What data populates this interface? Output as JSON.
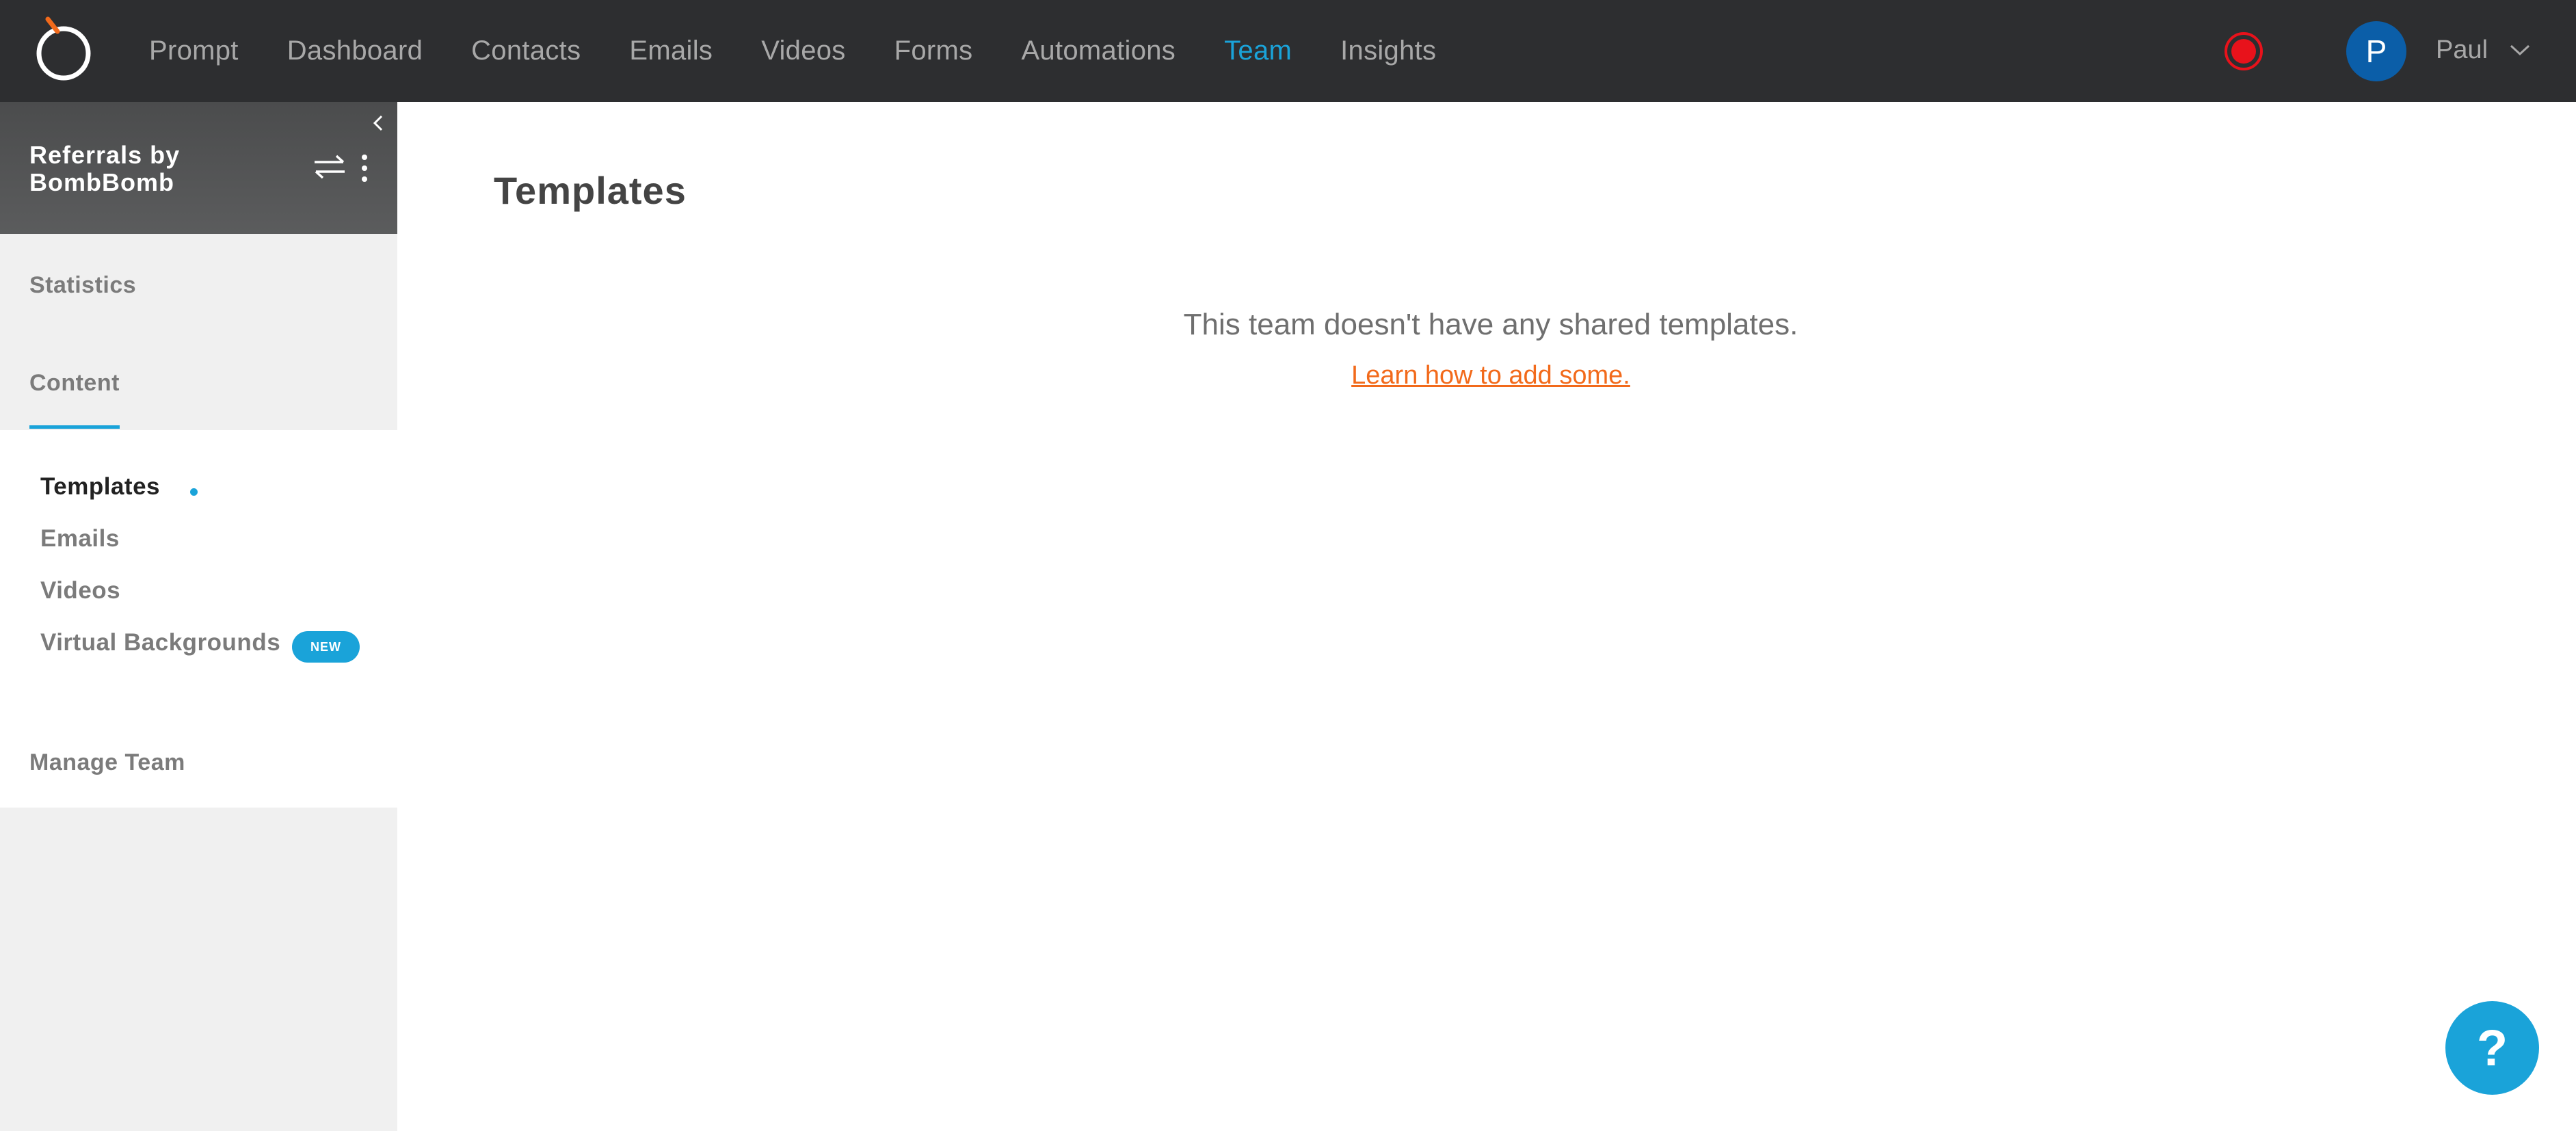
{
  "nav": {
    "logo_icon": "bombbomb-logo-icon",
    "items": [
      {
        "label": "Prompt",
        "active": false
      },
      {
        "label": "Dashboard",
        "active": false
      },
      {
        "label": "Contacts",
        "active": false
      },
      {
        "label": "Emails",
        "active": false
      },
      {
        "label": "Videos",
        "active": false
      },
      {
        "label": "Forms",
        "active": false
      },
      {
        "label": "Automations",
        "active": false
      },
      {
        "label": "Team",
        "active": true
      },
      {
        "label": "Insights",
        "active": false
      }
    ],
    "record_icon": "record-icon",
    "user": {
      "avatar_initial": "P",
      "name": "Paul",
      "chevron_icon": "chevron-down-icon"
    }
  },
  "sidebar": {
    "team_name": "Referrals by BombBomb",
    "collapse_icon": "chevron-left-icon",
    "switch_icon": "switch-arrows-icon",
    "more_icon": "more-vertical-icon",
    "sections": {
      "statistics": "Statistics",
      "content": "Content",
      "manage_team": "Manage Team"
    },
    "content_items": [
      {
        "label": "Templates",
        "active": true
      },
      {
        "label": "Emails",
        "active": false
      },
      {
        "label": "Videos",
        "active": false
      },
      {
        "label": "Virtual Backgrounds",
        "active": false,
        "badge": "NEW"
      }
    ]
  },
  "main": {
    "title": "Templates",
    "empty_message": "This team doesn't have any shared templates.",
    "learn_link": "Learn how to add some."
  },
  "help": {
    "label": "?",
    "icon": "help-icon"
  },
  "colors": {
    "topbar_bg": "#2d2e30",
    "accent": "#1aa3d9",
    "link": "#f26a1b",
    "avatar": "#0b5ea8",
    "record": "#e8121b"
  }
}
